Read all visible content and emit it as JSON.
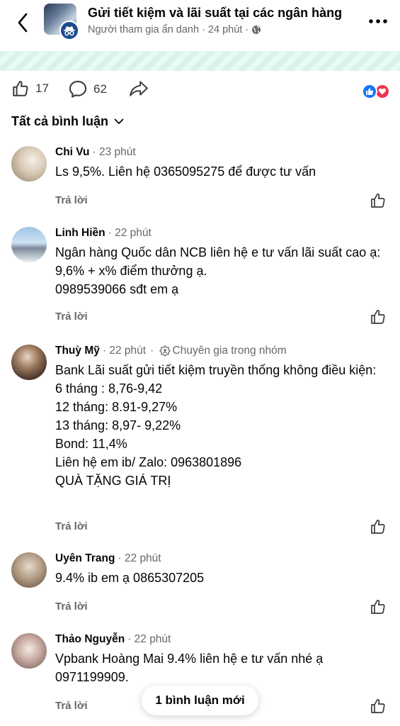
{
  "header": {
    "title": "Gửi tiết kiệm và lãi suất tại các ngân hàng",
    "author": "Người tham gia ẩn danh",
    "time": "24 phút",
    "separator": "·"
  },
  "actions": {
    "like_count": "17",
    "comment_count": "62"
  },
  "filter": {
    "label": "Tất cả bình luận"
  },
  "comments": [
    {
      "author": "Chi Vu",
      "time": "23 phút",
      "text": "Ls 9,5%. Liên hệ 0365095275 để được tư vấn",
      "reply": "Trả lời"
    },
    {
      "author": "Linh Hiền",
      "time": "22 phút",
      "text": "Ngân hàng Quốc dân NCB liên hệ e tư vấn lãi suất cao ạ: 9,6% + x% điểm thưởng ạ.\n0989539066 sđt em ạ",
      "reply": "Trả lời"
    },
    {
      "author": "Thuỳ Mỹ",
      "time": "22 phút",
      "badge": "Chuyên gia trong nhóm",
      "text": "Bank Lãi suất gửi tiết kiệm truyền thống không điều kiện:\n6 tháng :  8,76-9,42\n12 tháng:  8.91-9,27%\n13 tháng: 8,97- 9,22%\nBond: 11,4%\nLiên hệ em ib/ Zalo: 0963801896\nQUÀ TẶNG GIÁ TRỊ",
      "reply": "Trả lời"
    },
    {
      "author": "Uyên Trang",
      "time": "22 phút",
      "text": "9.4% ib em ạ 0865307205",
      "reply": "Trả lời"
    },
    {
      "author": "Thảo Nguyễn",
      "time": "22 phút",
      "text": "Vpbank Hoàng Mai 9.4% liên hệ e tư vấn nhé ạ\n0971199909.",
      "reply": "Trả lời"
    }
  ],
  "toast": {
    "label": "1 bình luận mới"
  },
  "colors": {
    "text": "#050505",
    "secondary": "#65676b",
    "like_blue": "#1877f2",
    "love_red": "#f0344e"
  },
  "icons": [
    "back-arrow-icon",
    "anonymous-icon",
    "globe-icon",
    "more-icon",
    "like-icon",
    "comment-icon",
    "share-icon",
    "chevron-down-icon",
    "expert-badge-icon"
  ]
}
